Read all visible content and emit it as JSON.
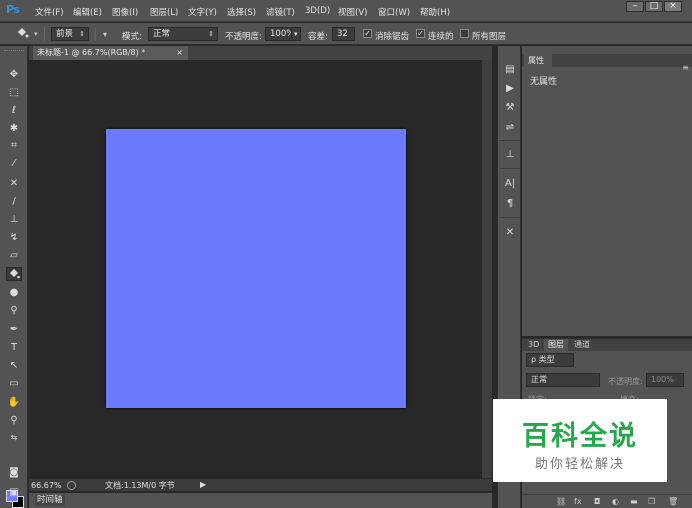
{
  "app": {
    "logo": "Ps"
  },
  "menubar": {
    "items": [
      "文件(F)",
      "编辑(E)",
      "图像(I)",
      "图层(L)",
      "文字(Y)",
      "选择(S)",
      "滤镜(T)",
      "3D(D)",
      "视图(V)",
      "窗口(W)",
      "帮助(H)"
    ],
    "window_controls": [
      "–",
      "□",
      "×"
    ]
  },
  "options": {
    "fill_source": "前景",
    "mode_label": "模式:",
    "mode_value": "正常",
    "opacity_label": "不透明度:",
    "opacity_value": "100%",
    "tolerance_label": "容差:",
    "tolerance_value": "32",
    "antialias_label": "消除锯齿",
    "contiguous_label": "连续的",
    "all_layers_label": "所有图层"
  },
  "document": {
    "tab_title": "未标题-1 @ 66.7%(RGB/8) *",
    "canvas_color": "#6b7bfb"
  },
  "status": {
    "zoom": "66.67%",
    "doc_info": "文档:1.13M/0 字节"
  },
  "timeline": {
    "label": "时间轴"
  },
  "colors": {
    "foreground": "#6b7bfb",
    "background": "#000000"
  },
  "properties": {
    "tab": "属性",
    "no_properties": "无属性"
  },
  "layers": {
    "tabs": [
      "3D",
      "图层",
      "通道"
    ],
    "filter_kind": "ρ 类型",
    "blend_mode": "正常",
    "opacity_label": "不透明度:",
    "opacity_value": "100%",
    "lock_label": "锁定:",
    "fill_label": "填充:"
  },
  "watermark": {
    "title": "百科全说",
    "subtitle": "助你轻松解决"
  }
}
